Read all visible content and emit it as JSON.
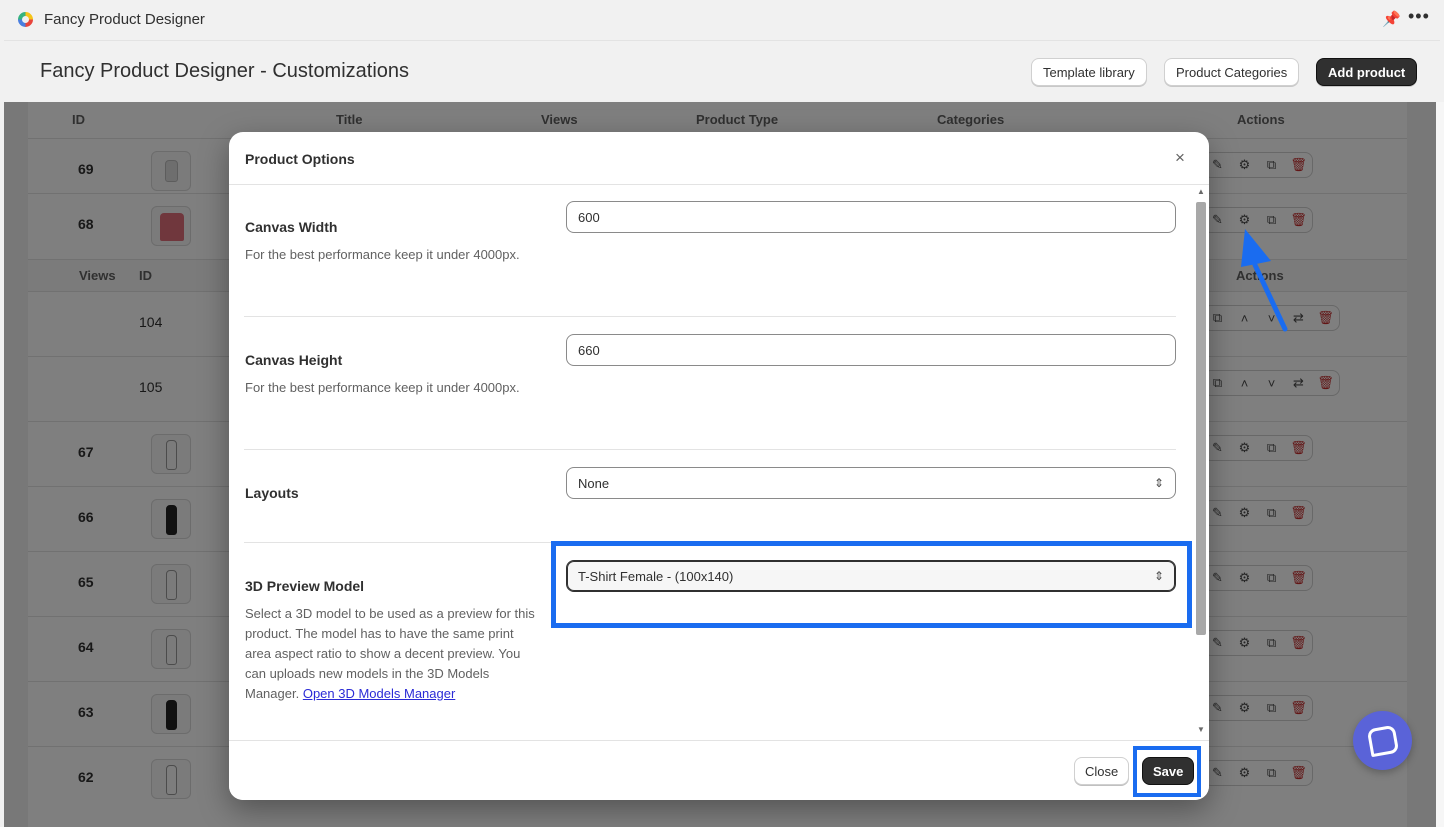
{
  "app": {
    "name": "Fancy Product Designer"
  },
  "header": {
    "title": "Fancy Product Designer - Customizations",
    "buttons": {
      "template": "Template library",
      "categories": "Product Categories",
      "add": "Add product"
    }
  },
  "table": {
    "columns": {
      "id": "ID",
      "title": "Title",
      "views": "Views",
      "type": "Product Type",
      "categories": "Categories",
      "actions": "Actions"
    },
    "sub_columns": {
      "views": "Views",
      "id": "ID",
      "actions": "Actions"
    },
    "rows": [
      {
        "id": "69",
        "thumb": "phone-case"
      },
      {
        "id": "68",
        "thumb": "tshirt"
      },
      {
        "id": "104",
        "kind": "view"
      },
      {
        "id": "105",
        "kind": "view"
      },
      {
        "id": "67",
        "thumb": "bottle-white"
      },
      {
        "id": "66",
        "thumb": "bottle-black"
      },
      {
        "id": "65",
        "thumb": "bottle-white"
      },
      {
        "id": "64",
        "thumb": "bottle-white"
      },
      {
        "id": "63",
        "thumb": "bottle-black"
      },
      {
        "id": "62",
        "thumb": "bottle-white"
      }
    ],
    "action_icons": [
      "edit-icon",
      "gear-icon",
      "duplicate-icon",
      "trash-icon"
    ]
  },
  "modal": {
    "title": "Product Options",
    "close_symbol": "×",
    "options": {
      "canvas_width": {
        "label": "Canvas Width",
        "help": "For the best performance keep it under 4000px.",
        "value": "600"
      },
      "canvas_height": {
        "label": "Canvas Height",
        "help": "For the best performance keep it under 4000px.",
        "value": "660"
      },
      "layouts": {
        "label": "Layouts",
        "value": "None"
      },
      "preview_model": {
        "label": "3D Preview Model",
        "help": "Select a 3D model to be used as a preview for this product. The model has to have the same print area aspect ratio to show a decent preview. You can uploads new models in the 3D Models Manager.",
        "link": "Open 3D Models Manager",
        "value": "T-Shirt Female - (100x140)"
      }
    },
    "footer": {
      "close": "Close",
      "save": "Save"
    }
  },
  "colors": {
    "accent": "#1a6cf0",
    "primary_button": "#303030",
    "chat": "#5a63d8",
    "danger": "#c42b2b"
  }
}
